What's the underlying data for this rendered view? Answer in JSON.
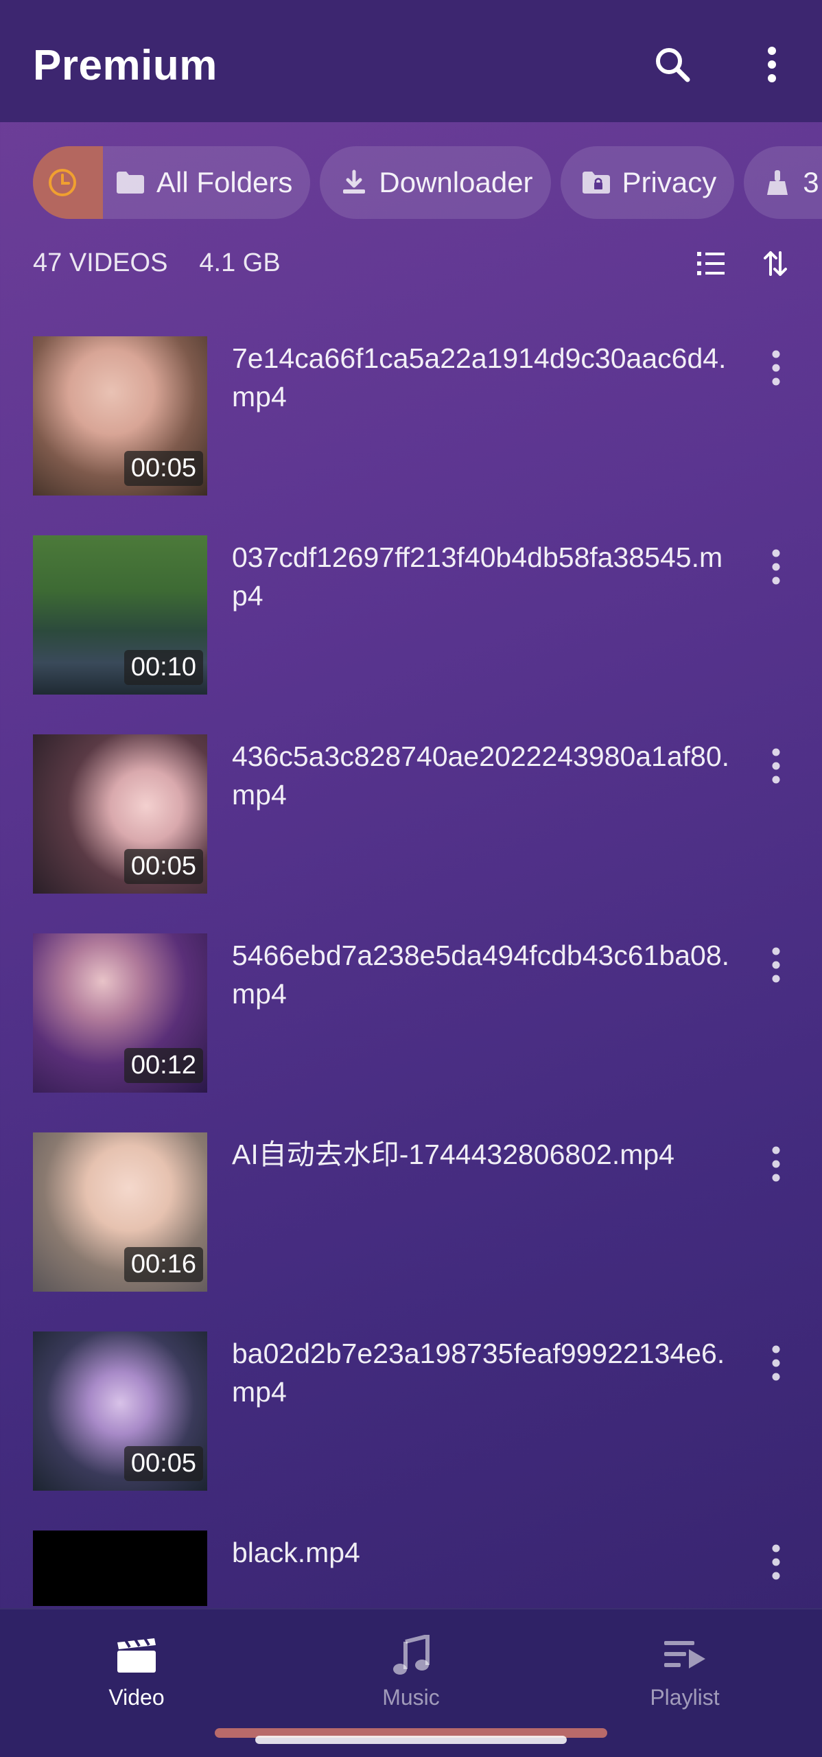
{
  "app": {
    "title": "Premium"
  },
  "chips": {
    "all_folders": "All Folders",
    "downloader": "Downloader",
    "privacy": "Privacy",
    "cleaner_partial": "3"
  },
  "stats": {
    "count": "47 VIDEOS",
    "size": "4.1 GB"
  },
  "videos": [
    {
      "name": "7e14ca66f1ca5a22a1914d9c30aac6d4.mp4",
      "duration": "00:05"
    },
    {
      "name": "037cdf12697ff213f40b4db58fa38545.mp4",
      "duration": "00:10"
    },
    {
      "name": "436c5a3c828740ae2022243980a1af80.mp4",
      "duration": "00:05"
    },
    {
      "name": "5466ebd7a238e5da494fcdb43c61ba08.mp4",
      "duration": "00:12"
    },
    {
      "name": "AI自动去水印-1744432806802.mp4",
      "duration": "00:16"
    },
    {
      "name": "ba02d2b7e23a198735feaf99922134e6.mp4",
      "duration": "00:05"
    },
    {
      "name": "black.mp4",
      "duration": ""
    }
  ],
  "bottom_nav": {
    "video": "Video",
    "music": "Music",
    "playlist": "Playlist"
  },
  "colors": {
    "accent_orange": "#f0a030",
    "appbar": "#3d2670",
    "nav": "#2f2266"
  }
}
